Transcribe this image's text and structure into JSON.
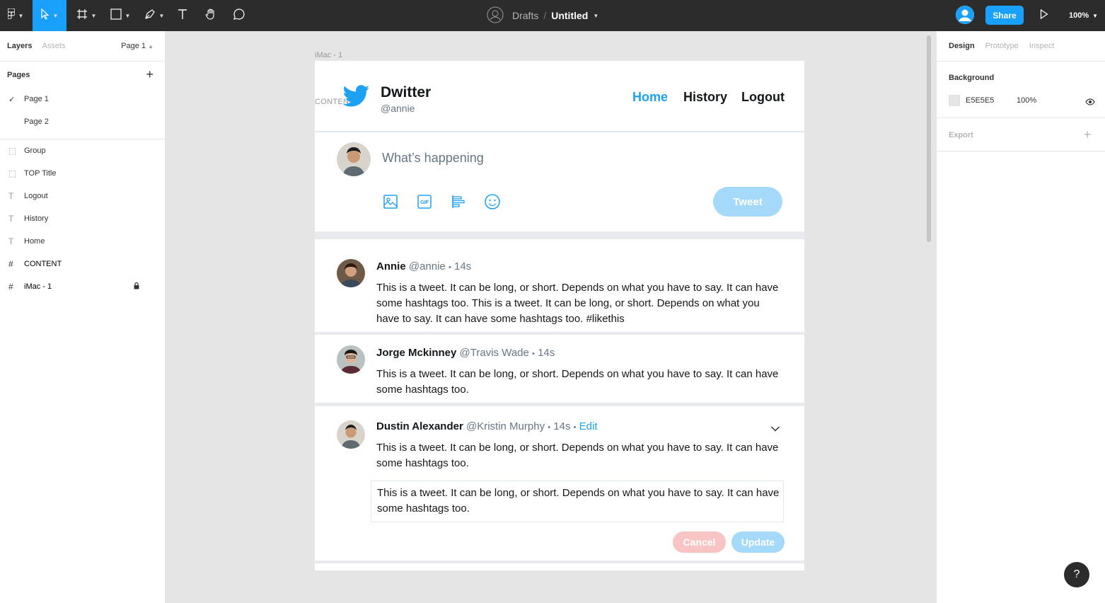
{
  "toolbar": {
    "drafts": "Drafts",
    "separator": "/",
    "doc_title": "Untitled",
    "share": "Share",
    "zoom": "100%"
  },
  "left_panel": {
    "tabs": {
      "layers": "Layers",
      "assets": "Assets",
      "page_select": "Page 1"
    },
    "pages_title": "Pages",
    "pages": [
      "Page 1",
      "Page 2"
    ],
    "layers": [
      "Group",
      "TOP Title",
      "Logout",
      "History",
      "Home",
      "CONTENT",
      "iMac - 1"
    ]
  },
  "canvas": {
    "frame_label": "iMac - 1",
    "content_tag": "CONTENT",
    "brand": {
      "name": "Dwitter",
      "handle": "@annie"
    },
    "nav": {
      "home": "Home",
      "history": "History",
      "logout": "Logout"
    },
    "composer": {
      "placeholder": "What’s happening",
      "tweet_button": "Tweet"
    },
    "tweets": [
      {
        "name": "Annie",
        "handle": "@annie",
        "dot": "•",
        "time": "14s",
        "text": "This is a tweet. It can be long, or short. Depends on what you have to say. It can have some hashtags too. This is a tweet. It can be long, or short. Depends on what you have to say. It can have some hashtags too. #likethis"
      },
      {
        "name": "Jorge Mckinney",
        "handle": "@Travis Wade",
        "dot": "•",
        "time": "14s",
        "text": "This is a tweet. It can be long, or short. Depends on what you have to say. It can have some hashtags too."
      },
      {
        "name": "Dustin Alexander",
        "handle": "@Kristin Murphy",
        "dot": "•",
        "time": "14s",
        "edit": "Edit",
        "text": "This is a tweet. It can be long, or short. Depends on what you have to say. It can have some hashtags too.",
        "edit_value": "This is a tweet. It can be long, or short. Depends on what you have to say. It can have some hashtags too.",
        "cancel": "Cancel",
        "update": "Update"
      }
    ]
  },
  "right_panel": {
    "tabs": {
      "design": "Design",
      "prototype": "Prototype",
      "inspect": "Inspect"
    },
    "background_title": "Background",
    "background_hex": "E5E5E5",
    "background_opacity": "100%",
    "export_title": "Export"
  },
  "help": "?",
  "colors": {
    "accent": "#18a0fb",
    "twitter_blue": "#1da1f2",
    "toolbar_bg": "#2c2c2c",
    "canvas_bg": "#e5e5e5",
    "cancel_bg": "#f9c4c4",
    "button_disabled": "#a5d9fa"
  }
}
